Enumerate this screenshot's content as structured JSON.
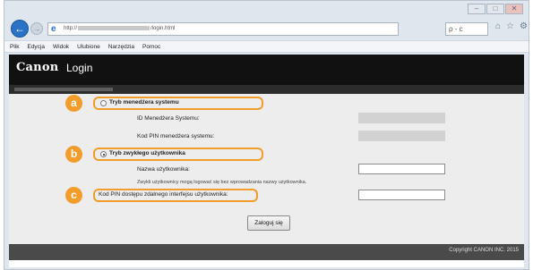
{
  "browser": {
    "url": "http://",
    "url_suffix": "/login.html",
    "search_label": "ρ - c",
    "icons": [
      "back-arrow-icon",
      "forward-arrow-icon",
      "ie-page-icon",
      "home-icon",
      "star-icon",
      "gear-icon"
    ]
  },
  "menu": [
    "Plik",
    "Edycja",
    "Widok",
    "Ulubione",
    "Narzędzia",
    "Pomoc"
  ],
  "header": {
    "logo": "Canon",
    "title": "Login"
  },
  "form": {
    "system_manager_mode": "Tryb menedżera systemu",
    "system_manager_id_label": "ID Menedżera Systemu:",
    "system_manager_pin_label": "Kod PIN menedżera systemu:",
    "general_user_mode": "Tryb zwykłego użytkownika",
    "username_label": "Nazwa użytkownika:",
    "username_note": "Zwykli użytkownicy mogą logować się bez wprowadzania nazwy użytkownika.",
    "remote_ui_pin_label": "Kod PIN dostępu zdalnego interfejsu użytkownika:",
    "login_button": "Zaloguj się"
  },
  "annotations": {
    "a": "a",
    "b": "b",
    "c": "c",
    "color": "#f29d2b"
  },
  "footer": {
    "copyright": "Copyright CANON INC. 2015"
  }
}
